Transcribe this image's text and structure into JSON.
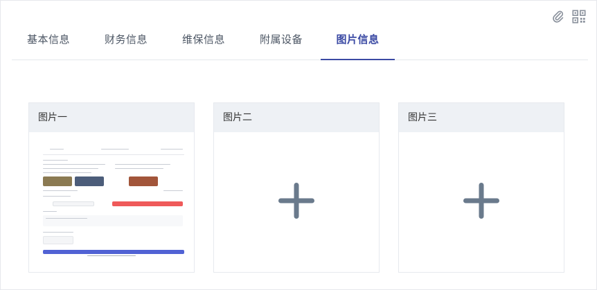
{
  "tabs": [
    {
      "label": "基本信息",
      "active": false
    },
    {
      "label": "财务信息",
      "active": false
    },
    {
      "label": "维保信息",
      "active": false
    },
    {
      "label": "附属设备",
      "active": false
    },
    {
      "label": "图片信息",
      "active": true
    }
  ],
  "icons": {
    "attachment": "paperclip-icon",
    "qrcode": "qrcode-icon",
    "add": "plus-icon"
  },
  "colors": {
    "accent": "#3b4aa4",
    "plus": "#6a7a8c",
    "card_header_bg": "#eef1f5"
  },
  "cards": [
    {
      "title": "图片一",
      "has_image": true
    },
    {
      "title": "图片二",
      "has_image": false
    },
    {
      "title": "图片三",
      "has_image": false
    }
  ]
}
